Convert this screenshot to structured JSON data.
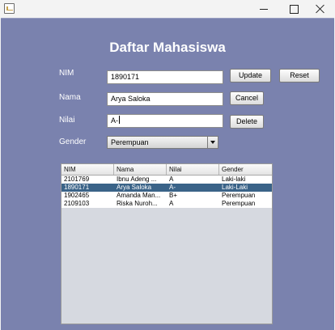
{
  "window": {
    "title": ""
  },
  "form": {
    "title": "Daftar Mahasiswa",
    "nim_label": "NIM",
    "nama_label": "Nama",
    "nilai_label": "Nilai",
    "gender_label": "Gender",
    "nim_value": "1890171",
    "nama_value": "Arya Saloka",
    "nilai_value": "A-",
    "gender_value": "Perempuan"
  },
  "buttons": {
    "update": "Update",
    "reset": "Reset",
    "cancel": "Cancel",
    "delete": "Delete"
  },
  "table": {
    "columns": [
      "NIM",
      "Nama",
      "Nilai",
      "Gender"
    ],
    "rows": [
      [
        "2101769",
        "Ibnu Adeng ...",
        "A",
        "Laki-laki"
      ],
      [
        "1890171",
        "Arya Saloka",
        "A-",
        "Laki-Laki"
      ],
      [
        "1902465",
        "Amanda Man...",
        "B+",
        "Perempuan"
      ],
      [
        "2109103",
        "Riska Nuroh...",
        "A",
        "Perempuan"
      ]
    ],
    "selected_row": 1
  }
}
